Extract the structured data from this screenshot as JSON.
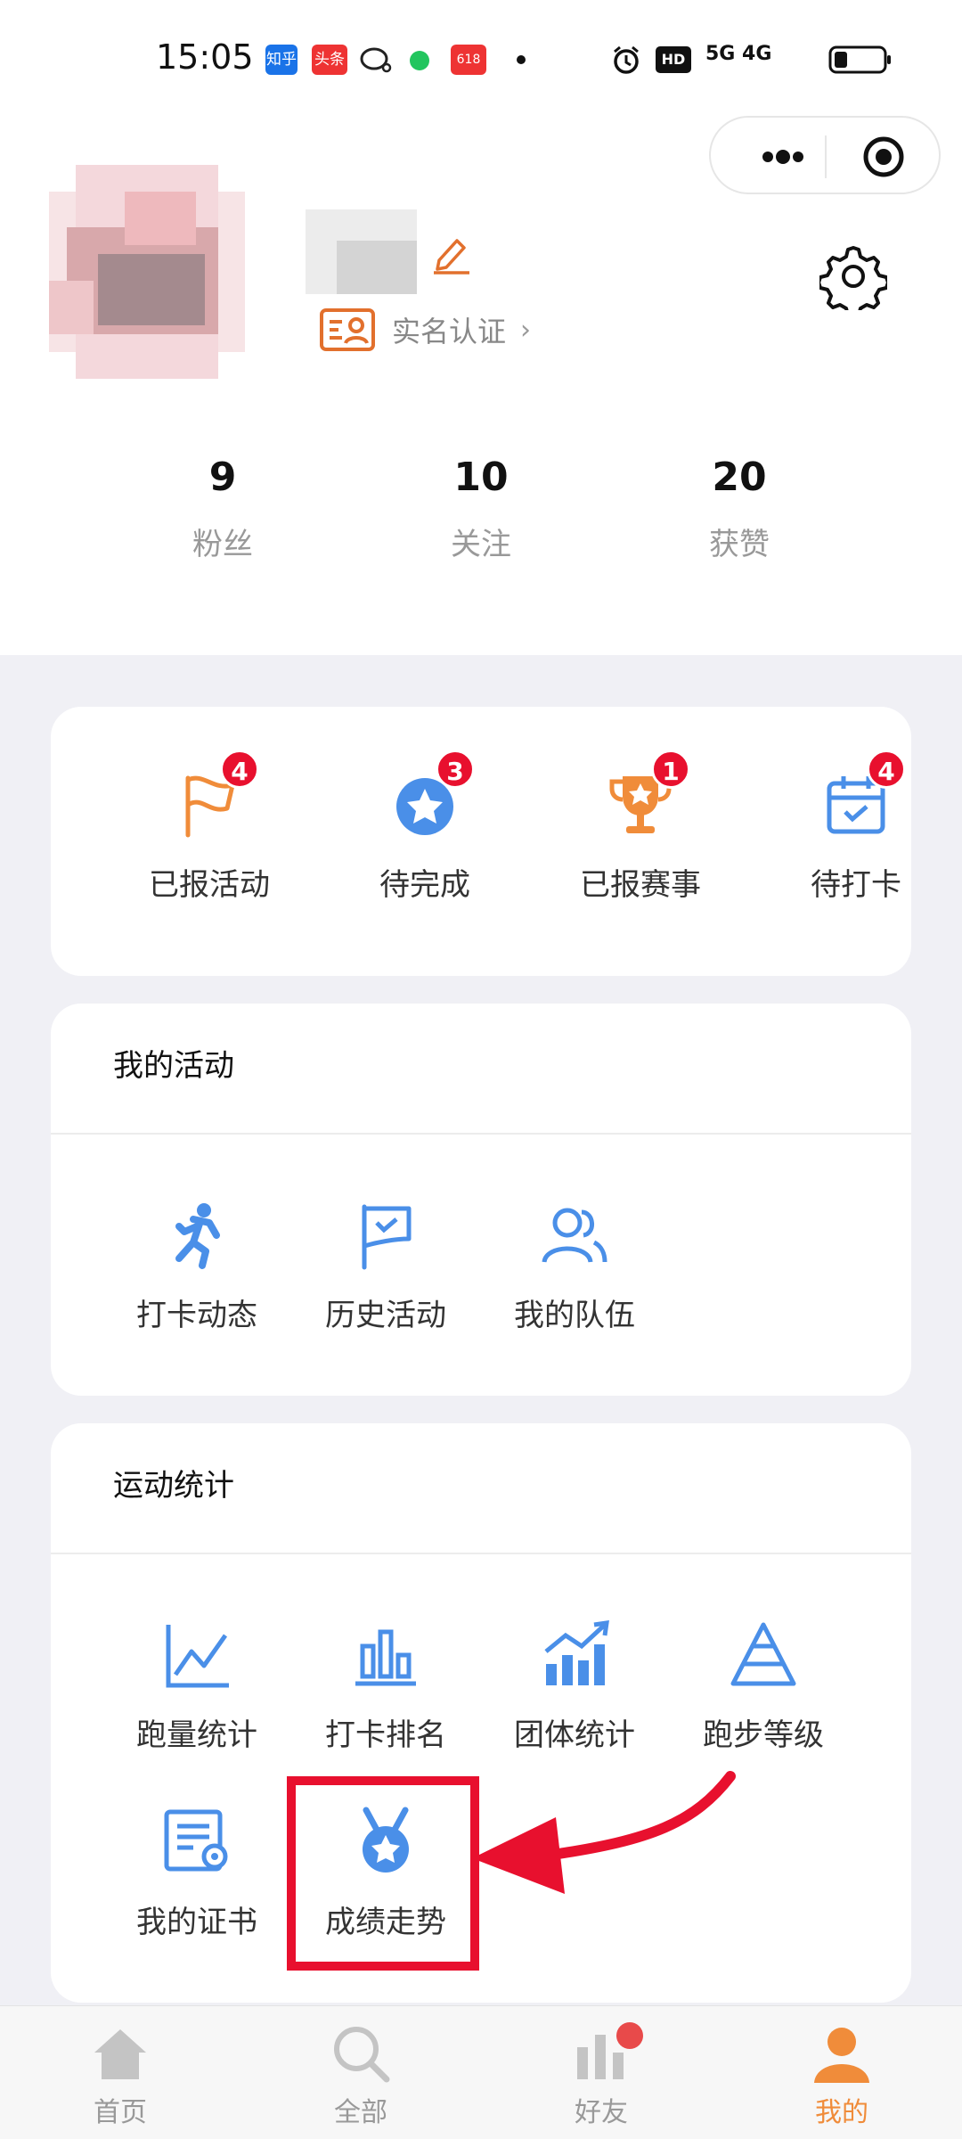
{
  "status_bar": {
    "time": "15:05",
    "apps": [
      "知乎",
      "头条",
      "618"
    ],
    "network": "5G 4G"
  },
  "profile": {
    "realname_label": "实名认证",
    "stats": [
      {
        "value": "9",
        "label": "粉丝"
      },
      {
        "value": "10",
        "label": "关注"
      },
      {
        "value": "20",
        "label": "获赞"
      }
    ]
  },
  "quick": [
    {
      "label": "已报活动",
      "badge": "4",
      "icon": "flag-icon"
    },
    {
      "label": "待完成",
      "badge": "3",
      "icon": "star-badge-icon"
    },
    {
      "label": "已报赛事",
      "badge": "1",
      "icon": "trophy-icon"
    },
    {
      "label": "待打卡",
      "badge": "4",
      "icon": "calendar-check-icon"
    }
  ],
  "activities": {
    "title": "我的活动",
    "items": [
      {
        "label": "打卡动态",
        "icon": "runner-icon"
      },
      {
        "label": "历史活动",
        "icon": "flag-check-icon"
      },
      {
        "label": "我的队伍",
        "icon": "team-icon"
      }
    ]
  },
  "sports": {
    "title": "运动统计",
    "items": [
      {
        "label": "跑量统计",
        "icon": "line-chart-icon"
      },
      {
        "label": "打卡排名",
        "icon": "bar-chart-icon"
      },
      {
        "label": "团体统计",
        "icon": "trend-bar-icon"
      },
      {
        "label": "跑步等级",
        "icon": "pyramid-icon"
      },
      {
        "label": "我的证书",
        "icon": "certificate-icon"
      },
      {
        "label": "成绩走势",
        "icon": "medal-icon"
      }
    ]
  },
  "tabs": [
    {
      "label": "首页",
      "icon": "home-icon"
    },
    {
      "label": "全部",
      "icon": "search-icon"
    },
    {
      "label": "好友",
      "icon": "friends-icon"
    },
    {
      "label": "我的",
      "icon": "person-icon"
    }
  ],
  "colors": {
    "accent_orange": "#f08c3a",
    "blue": "#4a8fe8",
    "badge_red": "#e8102e"
  }
}
